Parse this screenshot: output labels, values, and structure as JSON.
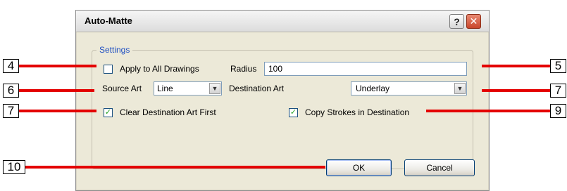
{
  "window": {
    "title": "Auto-Matte"
  },
  "titlebar": {
    "help_symbol": "?",
    "close_symbol": "✕"
  },
  "settings": {
    "group_label": "Settings",
    "apply_all_label": "Apply to All Drawings",
    "apply_all_checked": false,
    "radius_label": "Radius",
    "radius_value": "100",
    "source_art_label": "Source Art",
    "source_art_value": "Line",
    "destination_art_label": "Destination Art",
    "destination_art_value": "Underlay",
    "clear_dest_label": "Clear Destination Art First",
    "clear_dest_checked": true,
    "copy_strokes_label": "Copy Strokes in Destination",
    "copy_strokes_checked": true,
    "check_glyph": "✓"
  },
  "buttons": {
    "ok_label": "OK",
    "cancel_label": "Cancel"
  },
  "callouts": {
    "c4": "4",
    "c5": "5",
    "c6": "6",
    "c7a": "7",
    "c7b": "7",
    "c9": "9",
    "c10": "10"
  },
  "colors": {
    "callout_line": "#e40000",
    "group_label": "#1f4fc2"
  }
}
